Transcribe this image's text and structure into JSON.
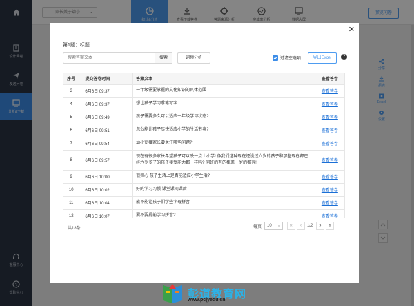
{
  "sidebar": {
    "items": [
      {
        "label": "设计问卷",
        "icon": "edit-icon"
      },
      {
        "label": "发送问卷",
        "icon": "send-icon"
      },
      {
        "label": "分析&下载",
        "icon": "analysis-icon",
        "active": true
      }
    ],
    "bottom": [
      {
        "label": "客服中心",
        "icon": "headset-icon"
      },
      {
        "label": "帮助中心",
        "icon": "help-icon"
      }
    ]
  },
  "topbar": {
    "survey_select": "家长关于幼小",
    "tabs": [
      {
        "label": "统计&分析",
        "icon": "pie-chart-icon",
        "active": true
      },
      {
        "label": "查看下载答卷",
        "icon": "download-icon"
      },
      {
        "label": "答题来源分析",
        "icon": "target-icon"
      },
      {
        "label": "完成率分析",
        "icon": "check-circle-icon"
      },
      {
        "label": "数据大屏",
        "icon": "dashboard-icon"
      }
    ],
    "preview_label": "预览问卷"
  },
  "right_tools": [
    {
      "label": "分享",
      "icon": "share-icon"
    },
    {
      "label": "报表",
      "icon": "report-icon"
    },
    {
      "label": "Excel",
      "icon": "excel-icon"
    },
    {
      "label": "设置",
      "icon": "settings-icon"
    }
  ],
  "modal": {
    "question_title": "第1题：标题",
    "search_placeholder": "搜索答案文本",
    "search_label": "搜索",
    "wordcloud_label": "词频分析",
    "filter_label": "过滤空选项",
    "filter_checked": true,
    "export_label": "导出Excel",
    "help_glyph": "?",
    "columns": {
      "num": "序号",
      "time": "提交答卷时间",
      "answer": "答案文本",
      "action": "查看答卷"
    },
    "rows": [
      {
        "num": "3",
        "time": "6月6日 09:37",
        "answer": "一年级需要掌握的文化知识的具体范围",
        "action": "查看答卷"
      },
      {
        "num": "4",
        "time": "6月6日 09:37",
        "answer": "想让孩子学习拿笔写字",
        "action": "查看答卷"
      },
      {
        "num": "5",
        "time": "6月6日 09:49",
        "answer": "孩子需要多久可以适应一年级学习状态?",
        "action": "查看答卷"
      },
      {
        "num": "6",
        "time": "6月6日 09:51",
        "answer": "怎么能让孩子尽快适应小学的生活节奏?",
        "action": "查看答卷"
      },
      {
        "num": "7",
        "time": "6月6日 09:54",
        "answer": "幼小衔接家长要关注哪些问题?",
        "action": "查看答卷"
      },
      {
        "num": "8",
        "time": "6月6日 09:57",
        "answer": "现在有很多家长希望孩子可以晚一点上小学! 像我们这种现在还没过六岁的孩子和那些现在都已经六岁多了的孩子接受能力都一样吗? 同班的有的相差一岁的都有!",
        "action": "查看答卷",
        "tall": true
      },
      {
        "num": "9",
        "time": "6月6日 10:00",
        "answer": "很担心 孩子生活上是否能适应小学生活?",
        "action": "查看答卷"
      },
      {
        "num": "10",
        "time": "6月6日 10:02",
        "answer": "好的学习习惯 课堂课间课后",
        "action": "查看答卷"
      },
      {
        "num": "11",
        "time": "6月6日 10:04",
        "answer": "能不能让孩子们学些字母拼音",
        "action": "查看答卷"
      },
      {
        "num": "12",
        "time": "6月6日 10:07",
        "answer": "要不要提前学习拼音?",
        "action": "查看答卷"
      }
    ],
    "total_text": "共18条",
    "pager": {
      "per_page_label": "每页",
      "per_page_value": "10",
      "page_text": "1/2",
      "first": "«",
      "prev": "‹",
      "next": "›",
      "last": "»"
    }
  },
  "watermark": {
    "title": "彭道教育网",
    "url": "www.pcjyedu.cn"
  }
}
